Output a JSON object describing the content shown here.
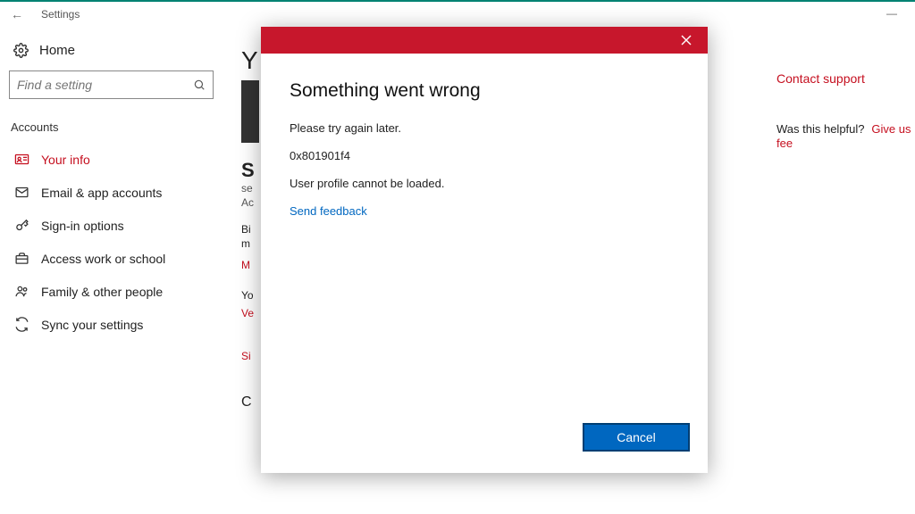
{
  "window": {
    "title": "Settings"
  },
  "home_label": "Home",
  "search": {
    "placeholder": "Find a setting"
  },
  "section_header": "Accounts",
  "nav": {
    "your_info": "Your info",
    "email_accounts": "Email & app accounts",
    "sign_in": "Sign-in options",
    "access_work": "Access work or school",
    "family": "Family & other people",
    "sync": "Sync your settings"
  },
  "content": {
    "y": "Y",
    "s": "S",
    "se": "se",
    "ac": "Ac",
    "bi": "Bi",
    "m": "m",
    "mred": "M",
    "yo": "Yo",
    "ve": "Ve",
    "si": "Si",
    "c": "C"
  },
  "right_rail": {
    "contact": "Contact support",
    "helpful": "Was this helpful?",
    "give_feedback": "Give us fee"
  },
  "dialog": {
    "title": "Something went wrong",
    "line1": "Please try again later.",
    "code": "0x801901f4",
    "line2": "User profile cannot be loaded.",
    "feedback_link": "Send feedback",
    "cancel": "Cancel"
  }
}
